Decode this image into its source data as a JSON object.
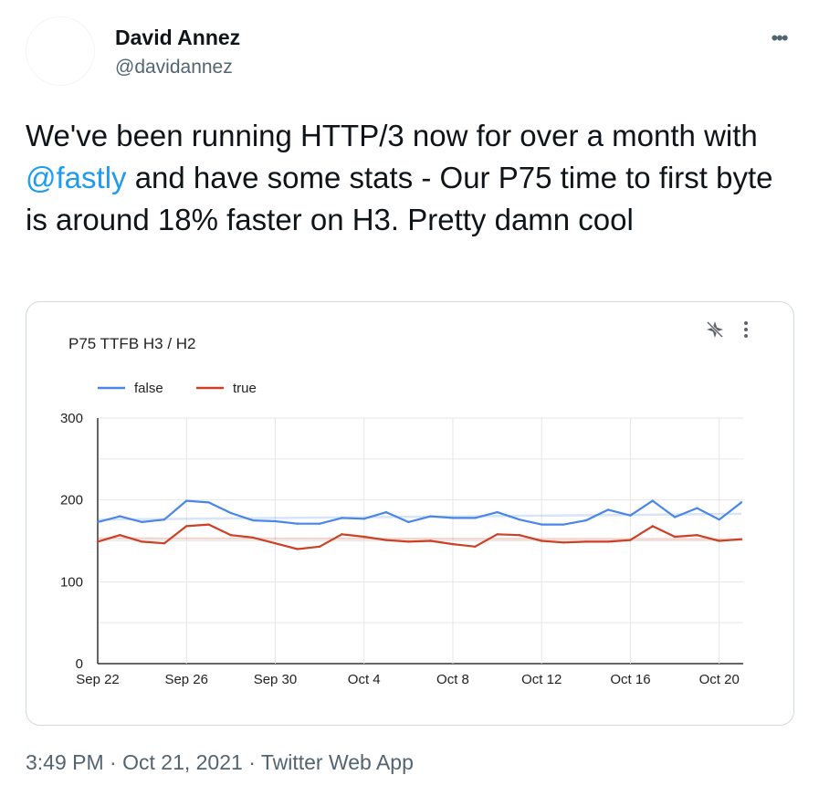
{
  "author": {
    "display_name": "David Annez",
    "handle": "@davidannez"
  },
  "more_icon": "more-horizontal-icon",
  "tweet": {
    "text_part1": "We've been running HTTP/3 now for over a month with ",
    "mention": "@fastly",
    "text_part2": " and have some stats - Our P75 time to first byte is around 18% faster on H3. Pretty damn cool"
  },
  "chart_tools": {
    "explore_icon": "explore-sparkle-icon",
    "menu_icon": "vertical-dots-menu-icon"
  },
  "chart_data": {
    "type": "line",
    "title": "P75 TTFB H3 / H2",
    "legend_position": "top-left",
    "grid": true,
    "ylim": [
      0,
      300
    ],
    "yticks": [
      0,
      100,
      200,
      300
    ],
    "x": [
      "Sep 22",
      "Sep 23",
      "Sep 24",
      "Sep 25",
      "Sep 26",
      "Sep 27",
      "Sep 28",
      "Sep 29",
      "Sep 30",
      "Oct 1",
      "Oct 2",
      "Oct 3",
      "Oct 4",
      "Oct 5",
      "Oct 6",
      "Oct 7",
      "Oct 8",
      "Oct 9",
      "Oct 10",
      "Oct 11",
      "Oct 12",
      "Oct 13",
      "Oct 14",
      "Oct 15",
      "Oct 16",
      "Oct 17",
      "Oct 18",
      "Oct 19",
      "Oct 20",
      "Oct 21"
    ],
    "xtick_labels": [
      "Sep 22",
      "Sep 26",
      "Sep 30",
      "Oct 4",
      "Oct 8",
      "Oct 12",
      "Oct 16",
      "Oct 20"
    ],
    "series": [
      {
        "name": "false",
        "color": "#4a86e8",
        "values": [
          173,
          180,
          173,
          176,
          199,
          197,
          184,
          175,
          174,
          171,
          171,
          178,
          177,
          185,
          173,
          180,
          178,
          178,
          185,
          176,
          170,
          170,
          175,
          188,
          181,
          199,
          179,
          190,
          176,
          197
        ],
        "trend": [
          176,
          183
        ]
      },
      {
        "name": "true",
        "color": "#cc4125",
        "values": [
          149,
          157,
          149,
          147,
          168,
          170,
          157,
          154,
          147,
          140,
          143,
          158,
          155,
          151,
          149,
          150,
          146,
          143,
          158,
          157,
          150,
          148,
          149,
          149,
          151,
          168,
          155,
          157,
          150,
          152
        ],
        "trend": [
          153,
          152
        ]
      }
    ]
  },
  "footer": {
    "time": "3:49 PM",
    "separator1": " · ",
    "date": "Oct 21, 2021",
    "separator2": " · ",
    "source": "Twitter Web App"
  }
}
